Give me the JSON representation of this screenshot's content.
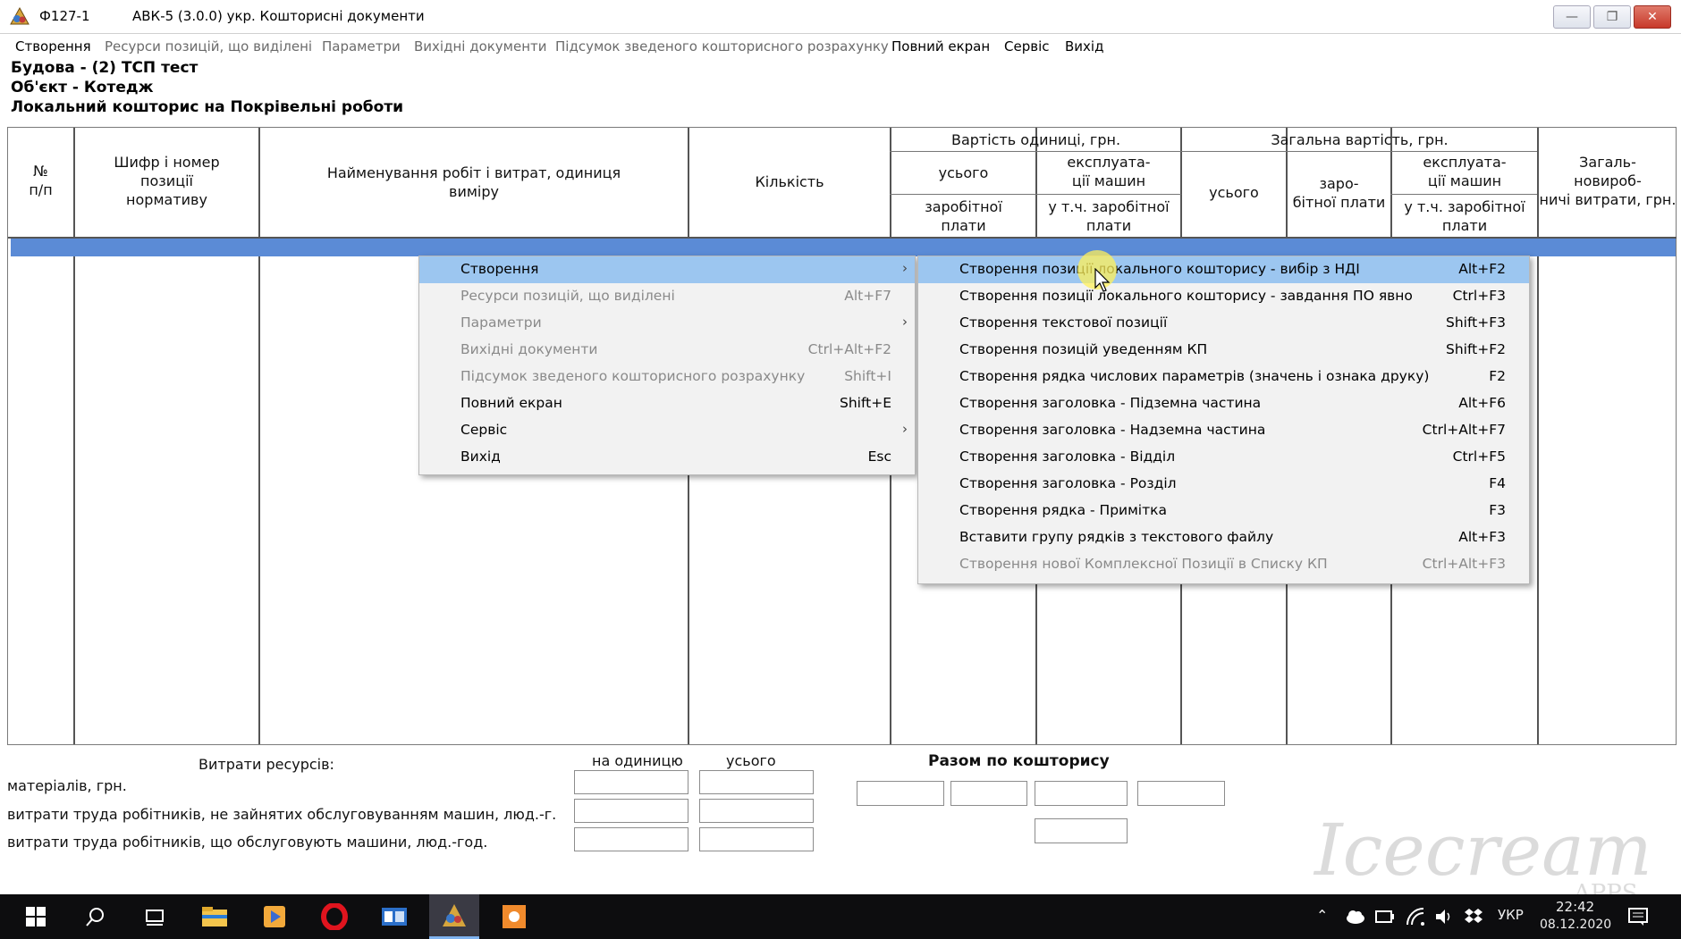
{
  "window": {
    "doc_id": "Ф127-1",
    "title": "АВК-5 (3.0.0) укр. Кошторисні документи",
    "buttons": {
      "minimize": "—",
      "maximize": "❐",
      "close": "✕"
    }
  },
  "menubar": [
    {
      "label": "Створення",
      "dim": false
    },
    {
      "label": "Ресурси позицій, що виділені",
      "dim": true
    },
    {
      "label": "Параметри",
      "dim": true
    },
    {
      "label": "Вихідні документи",
      "dim": true
    },
    {
      "label": "Підсумок зведеного кошторисного розрахунку",
      "dim": true
    },
    {
      "label": "Повний екран",
      "dim": false
    },
    {
      "label": "Сервіс",
      "dim": false
    },
    {
      "label": "Вихід",
      "dim": false
    }
  ],
  "info": {
    "line1": "Будова - (2) ТСП тест",
    "line2": "Об'єкт - Котедж",
    "line3": "Локальний кошторис на Покрівельні роботи"
  },
  "table_header": {
    "col_num": "№\nп/п",
    "col_code": "Шифр і номер\nпозиції\nнормативу",
    "col_name": "Найменування робіт і витрат, одиниця\nвиміру",
    "col_qty": "Кількість",
    "unit_cost_group": "Вартість одиниці, грн.",
    "unit_total": "усього",
    "unit_machine": "експлуата-\nції машин",
    "unit_wage": "заробітної\nплати",
    "unit_machine_wage": "у т.ч. заробітної\nплати",
    "total_cost_group": "Загальна вартість, грн.",
    "total_total": "усього",
    "total_wage": "заро-\nбітної плати",
    "total_machine": "експлуата-\nції машин",
    "total_machine_wage": "у т.ч. заробітної\nплати",
    "col_overhead": "Загаль-\nновироб-\nничі витрати, грн."
  },
  "bottom": {
    "resources_title": "Витрати ресурсів:",
    "per_unit": "на одиницю",
    "total": "усього",
    "row1": "матеріалів, грн.",
    "row2": "витрати труда робітників, не зайнятих обслуговуванням машин, люд.-г.",
    "row3": "витрати труда робітників, що обслуговують машини, люд.-год.",
    "estimate_total": "Разом  по  кошторису"
  },
  "context_menu": [
    {
      "label": "Створення",
      "shortcut": "",
      "submenu": true,
      "highlighted": true,
      "disabled": false
    },
    {
      "label": "Ресурси позицій, що виділені",
      "shortcut": "Alt+F7",
      "submenu": false,
      "highlighted": false,
      "disabled": true
    },
    {
      "label": "Параметри",
      "shortcut": "",
      "submenu": true,
      "highlighted": false,
      "disabled": true
    },
    {
      "label": "Вихідні документи",
      "shortcut": "Ctrl+Alt+F2",
      "submenu": false,
      "highlighted": false,
      "disabled": true
    },
    {
      "label": "Підсумок зведеного кошторисного розрахунку",
      "shortcut": "Shift+I",
      "submenu": false,
      "highlighted": false,
      "disabled": true
    },
    {
      "label": "Повний екран",
      "shortcut": "Shift+E",
      "submenu": false,
      "highlighted": false,
      "disabled": false
    },
    {
      "label": "Сервіс",
      "shortcut": "",
      "submenu": true,
      "highlighted": false,
      "disabled": false
    },
    {
      "label": "Вихід",
      "shortcut": "Esc",
      "submenu": false,
      "highlighted": false,
      "disabled": false
    }
  ],
  "submenu": [
    {
      "label": "Створення позиції локального кошторису - вибір з НДІ",
      "shortcut": "Alt+F2",
      "highlighted": true,
      "disabled": false
    },
    {
      "label": "Створення позиції локального кошторису - завдання  ПО явно",
      "shortcut": "Ctrl+F3",
      "highlighted": false,
      "disabled": false
    },
    {
      "label": "Створення текстової позиції",
      "shortcut": "Shift+F3",
      "highlighted": false,
      "disabled": false
    },
    {
      "label": "Створення позицій уведенням КП",
      "shortcut": "Shift+F2",
      "highlighted": false,
      "disabled": false
    },
    {
      "label": "Створення рядка числових параметрів (значень і ознака друку)",
      "shortcut": "F2",
      "highlighted": false,
      "disabled": false
    },
    {
      "label": "Створення заголовка - Підземна частина",
      "shortcut": "Alt+F6",
      "highlighted": false,
      "disabled": false
    },
    {
      "label": "Створення заголовка - Надземна частина",
      "shortcut": "Ctrl+Alt+F7",
      "highlighted": false,
      "disabled": false
    },
    {
      "label": "Створення заголовка - Відділ",
      "shortcut": "Ctrl+F5",
      "highlighted": false,
      "disabled": false
    },
    {
      "label": "Створення заголовка - Розділ",
      "shortcut": "F4",
      "highlighted": false,
      "disabled": false
    },
    {
      "label": "Створення рядка - Примітка",
      "shortcut": "F3",
      "highlighted": false,
      "disabled": false
    },
    {
      "label": "Вставити групу рядків з текстового файлу",
      "shortcut": "Alt+F3",
      "highlighted": false,
      "disabled": false
    },
    {
      "label": "Створення нової Комплексної Позиції в Списку КП",
      "shortcut": "Ctrl+Alt+F3",
      "highlighted": false,
      "disabled": true
    }
  ],
  "taskbar": {
    "language": "УКР",
    "time": "22:42",
    "date": "08.12.2020"
  },
  "watermark": {
    "text": "Icecream",
    "sub": "APPS"
  },
  "colors": {
    "highlight": "#9cc6f0",
    "selected_row": "#5b8bd6",
    "taskbar": "#0d0d0f"
  }
}
